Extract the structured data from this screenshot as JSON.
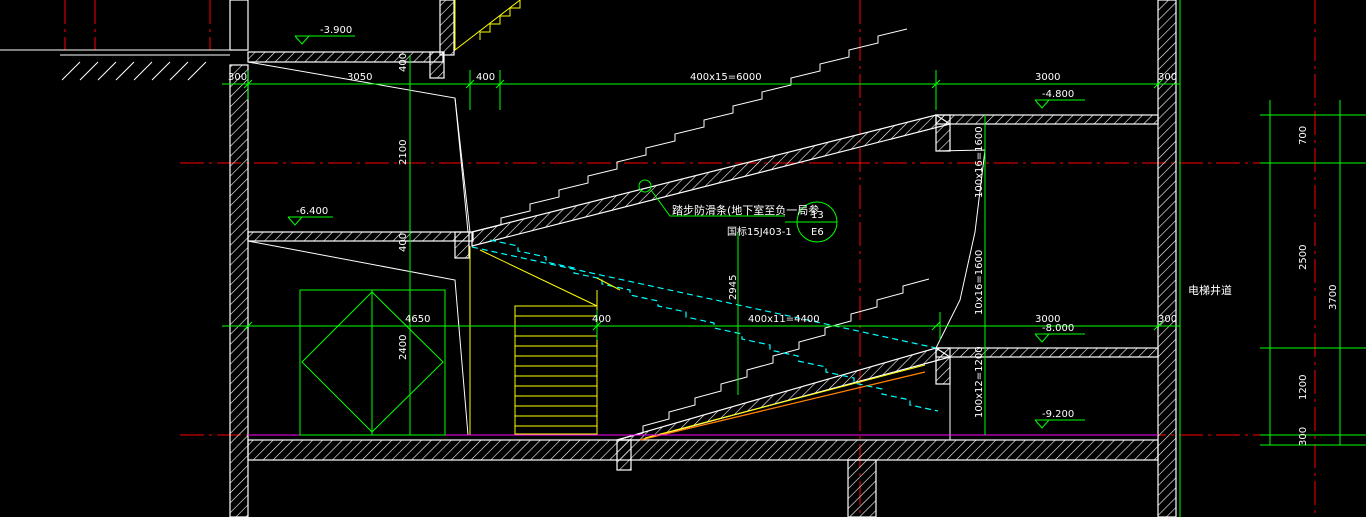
{
  "colors": {
    "background": "#000000",
    "wall": "#ffffff",
    "dimension": "#00ff00",
    "label": "#ffffff",
    "stair": "#ffff00",
    "hidden_stair": "#00ffff",
    "center_line": "#ff0000",
    "floor_line": "#ff00ff",
    "rail": "#ff8000"
  },
  "levels": {
    "top": "-3.900",
    "upper_landing": "-4.800",
    "mid_left": "-6.400",
    "lower_landing": "-8.000",
    "bottom": "-9.200"
  },
  "dims_top": {
    "d1": "300",
    "d2": "3050",
    "d3": "400",
    "d4": "400x15=6000",
    "d5": "3000",
    "d6": "300"
  },
  "dims_mid": {
    "d1": "4650",
    "d2": "400",
    "d3": "400x11=4400",
    "d4": "3000",
    "d5": "300"
  },
  "dims_vertical": {
    "left_2100": "2100",
    "left_400": "400",
    "left_400b": "400",
    "left_2400": "2400",
    "mid_2945": "2945",
    "stair_upper": "100x16=1600",
    "stair_mid": "10x16=1600",
    "stair_lower": "100x12=1200",
    "right_700": "700",
    "right_2500": "2500",
    "right_1200": "1200",
    "right_300": "300",
    "right_3700": "3700"
  },
  "annotations": {
    "stair_note": "踏步防滑条(地下室至负一局参",
    "stair_note_ref": "国标15J403-1",
    "detail_number": "13",
    "detail_sheet": "E6",
    "shaft_label": "电梯井道"
  }
}
